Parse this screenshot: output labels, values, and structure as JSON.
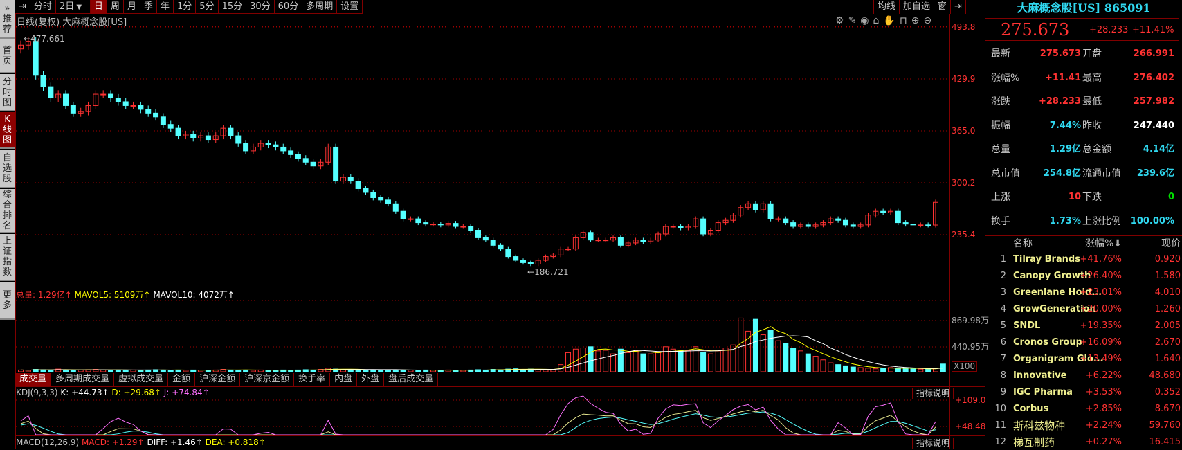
{
  "sidebar": {
    "items": [
      {
        "label": "推荐"
      },
      {
        "label": "首页"
      },
      {
        "label": "分时图"
      },
      {
        "label": "K线图",
        "active": true
      },
      {
        "label": "自选股"
      },
      {
        "label": "综合排名"
      },
      {
        "label": "上证指数"
      },
      {
        "label": "更多"
      }
    ]
  },
  "toolbar": {
    "items": [
      "分时",
      "2日",
      "日",
      "周",
      "月",
      "季",
      "年",
      "1分",
      "5分",
      "15分",
      "30分",
      "60分",
      "多周期",
      "设置"
    ],
    "active": "日",
    "dropdown_icon": "chevron-down-icon",
    "right_items": [
      "均线",
      "加自选",
      "窗"
    ]
  },
  "chart_header": {
    "title": "日线(复权)  大麻概念股[US]",
    "icons": [
      "gear-icon",
      "pen-icon",
      "eye-icon",
      "toolbox-icon",
      "hand-icon",
      "lock-icon",
      "zoom-in-icon",
      "zoom-out-icon"
    ]
  },
  "colors": {
    "up": "#ff3232",
    "down": "#54ffff",
    "grid": "#800000",
    "k": "#e8e890",
    "d": "#54ffff",
    "j": "#ff70ff",
    "mavol5": "#ffff00",
    "mavol10": "#ffffff"
  },
  "chart_data": {
    "type": "candlestick",
    "price_axis": {
      "ticks": [
        "493.8",
        "429.9",
        "365.0",
        "300.2",
        "235.4"
      ],
      "range": [
        235.4,
        493.8
      ]
    },
    "max_label": "477.661",
    "min_label": "186.721",
    "closes": [
      471.2,
      476,
      433.7,
      419.6,
      405.5,
      410.2,
      396.1,
      386.7,
      388.6,
      396.1,
      410.2,
      410.2,
      405.5,
      400.8,
      396.1,
      396.1,
      391.4,
      386.7,
      382,
      372.6,
      367.9,
      358.5,
      360.4,
      355.7,
      358.5,
      353.8,
      358.5,
      367.9,
      358.5,
      349.1,
      339.7,
      344.4,
      349.1,
      347.2,
      344.4,
      339.7,
      335,
      330.3,
      325.6,
      320.9,
      325.6,
      344.4,
      302.1,
      306.8,
      302.1,
      292.7,
      288,
      281.5,
      278.6,
      273.9,
      264.5,
      255.1,
      255.1,
      250.4,
      248.6,
      248.6,
      247.6,
      249.5,
      245.7,
      245.7,
      241,
      231.6,
      228.8,
      222.2,
      217.6,
      208.2,
      203.5,
      200.6,
      198.8,
      203.5,
      208.2,
      210.1,
      217.6,
      217.6,
      231.6,
      238.2,
      228.8,
      228.8,
      228.8,
      231.6,
      222.2,
      225.1,
      228.8,
      226.9,
      228.8,
      236.3,
      245.7,
      245.7,
      243.9,
      245.7,
      255.1,
      236.3,
      241,
      250.4,
      253.3,
      259.8,
      269.2,
      273.9,
      266.4,
      273.9,
      255.1,
      255.1,
      250.4,
      245.7,
      247.6,
      245.7,
      247.6,
      250.4,
      255.1,
      253.3,
      247.6,
      245.7,
      247.6,
      259.8,
      264.5,
      262.7,
      264.5,
      250.4,
      248.6,
      247.6,
      247.6,
      247.44,
      275.673
    ],
    "volumes": [
      30,
      25,
      40,
      35,
      30,
      45,
      30,
      25,
      30,
      35,
      40,
      30,
      25,
      30,
      28,
      30,
      25,
      30,
      35,
      30,
      28,
      30,
      25,
      30,
      28,
      25,
      30,
      40,
      30,
      28,
      30,
      25,
      30,
      28,
      25,
      30,
      28,
      30,
      35,
      30,
      40,
      60,
      45,
      40,
      35,
      30,
      28,
      30,
      25,
      30,
      35,
      30,
      28,
      25,
      30,
      28,
      25,
      30,
      28,
      25,
      30,
      35,
      30,
      40,
      35,
      45,
      50,
      40,
      45,
      40,
      35,
      38,
      120,
      320,
      380,
      400,
      420,
      350,
      360,
      300,
      380,
      320,
      350,
      300,
      300,
      320,
      420,
      380,
      350,
      360,
      420,
      330,
      300,
      350,
      400,
      450,
      900,
      680,
      880,
      620,
      700,
      520,
      480,
      400,
      350,
      300,
      260,
      200,
      150,
      120,
      100,
      80,
      70,
      60,
      50,
      60,
      70,
      60,
      55,
      50,
      45,
      40,
      60,
      130
    ],
    "volume_axis": {
      "ticks": [
        "869.98万",
        "440.95万"
      ],
      "multiplier": "X100"
    },
    "kdj_axis": {
      "ticks": [
        "+109.0",
        "+48.48"
      ]
    }
  },
  "volume_legend": {
    "total_label": "总量: 1.29亿↑",
    "mavol5": "MAVOL5: 5109万↑",
    "mavol10": "MAVOL10: 4072万↑"
  },
  "indicator_tabs": [
    "成交量",
    "多周期成交量",
    "虚拟成交量",
    "金额",
    "沪深金额",
    "沪深京金额",
    "换手率",
    "内盘",
    "外盘",
    "盘后成交量"
  ],
  "kdj_legend": {
    "name": "KDJ(9,3,3)",
    "k": "K: +44.73↑",
    "d": "D: +29.68↑",
    "j": "J: +74.84↑"
  },
  "macd_legend": {
    "name": "MACD(12,26,9)",
    "macd": "MACD: +1.29↑",
    "diff": "DIFF: +1.46↑",
    "dea": "DEA: +0.818↑"
  },
  "explain_button": "指标说明",
  "quote": {
    "title": "大麻概念股[US] 865091",
    "price": "275.673",
    "change": "+28.233",
    "change_pct": "+11.41%",
    "rows": [
      {
        "l1": "最新",
        "v1": "275.673",
        "c1": "#ff3232",
        "l2": "开盘",
        "v2": "266.991",
        "c2": "#ff3232"
      },
      {
        "l1": "涨幅%",
        "v1": "+11.41",
        "c1": "#ff3232",
        "l2": "最高",
        "v2": "276.402",
        "c2": "#ff3232"
      },
      {
        "l1": "涨跌",
        "v1": "+28.233",
        "c1": "#ff3232",
        "l2": "最低",
        "v2": "257.982",
        "c2": "#ff3232"
      },
      {
        "l1": "振幅",
        "v1": "7.44%",
        "c1": "#30d8f0",
        "l2": "昨收",
        "v2": "247.440",
        "c2": "#ffffff"
      },
      {
        "l1": "总量",
        "v1": "1.29亿",
        "c1": "#30d8f0",
        "l2": "总金额",
        "v2": "4.14亿",
        "c2": "#30d8f0"
      },
      {
        "l1": "总市值",
        "v1": "254.8亿",
        "c1": "#30d8f0",
        "l2": "流通市值",
        "v2": "239.6亿",
        "c2": "#30d8f0"
      },
      {
        "l1": "上涨",
        "v1": "10",
        "c1": "#ff3232",
        "l2": "下跌",
        "v2": "0",
        "c2": "#00e000"
      },
      {
        "l1": "换手",
        "v1": "1.73%",
        "c1": "#30d8f0",
        "l2": "上涨比例",
        "v2": "100.00%",
        "c2": "#30d8f0"
      }
    ]
  },
  "ranking": {
    "headers": {
      "name": "名称",
      "pct": "涨幅%",
      "price": "现价"
    },
    "sort_icon": "arrow-down-icon",
    "rows": [
      {
        "n": "1",
        "name": "Tilray Brands",
        "pct": "+41.76%",
        "price": "0.920"
      },
      {
        "n": "2",
        "name": "Canopy Growth",
        "pct": "+26.40%",
        "price": "1.580"
      },
      {
        "n": "3",
        "name": "Greenlane Hold...",
        "pct": "+23.01%",
        "price": "4.010"
      },
      {
        "n": "4",
        "name": "GrowGeneration",
        "pct": "+20.00%",
        "price": "1.260"
      },
      {
        "n": "5",
        "name": "SNDL",
        "pct": "+19.35%",
        "price": "2.005"
      },
      {
        "n": "6",
        "name": "Cronos Group",
        "pct": "+16.09%",
        "price": "2.670"
      },
      {
        "n": "7",
        "name": "Organigram Glo...",
        "pct": "+13.49%",
        "price": "1.640"
      },
      {
        "n": "8",
        "name": "Innovative",
        "pct": "+6.22%",
        "price": "48.680"
      },
      {
        "n": "9",
        "name": "IGC Pharma",
        "pct": "+3.53%",
        "price": "0.352"
      },
      {
        "n": "10",
        "name": "Corbus",
        "pct": "+2.85%",
        "price": "8.670"
      },
      {
        "n": "11",
        "name": "斯科兹物种",
        "pct": "+2.24%",
        "price": "59.760"
      },
      {
        "n": "12",
        "name": "梯瓦制药",
        "pct": "+0.27%",
        "price": "16.415"
      }
    ]
  }
}
